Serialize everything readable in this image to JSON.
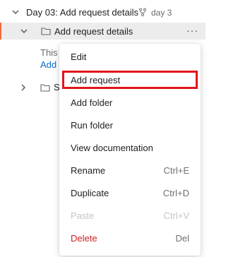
{
  "collection": {
    "title": "Day 03: Add request details",
    "fork_label": "day 3"
  },
  "folder": {
    "title": "Add request details",
    "more": "···"
  },
  "description": {
    "text_fragment": "This",
    "link_fragment": "Add"
  },
  "subfolder": {
    "label_fragment": "S"
  },
  "context_menu": {
    "items": [
      {
        "label": "Edit",
        "shortcut": ""
      },
      {
        "label": "Add request",
        "shortcut": ""
      },
      {
        "label": "Add folder",
        "shortcut": ""
      },
      {
        "label": "Run folder",
        "shortcut": ""
      },
      {
        "label": "View documentation",
        "shortcut": ""
      },
      {
        "label": "Rename",
        "shortcut": "Ctrl+E"
      },
      {
        "label": "Duplicate",
        "shortcut": "Ctrl+D"
      },
      {
        "label": "Paste",
        "shortcut": "Ctrl+V",
        "disabled": true
      },
      {
        "label": "Delete",
        "shortcut": "Del",
        "danger": true
      }
    ],
    "highlighted": "Add request"
  },
  "colors": {
    "accent": "#f26b3a",
    "highlight_box": "#e3141b",
    "danger": "#d01f1f",
    "link": "#0b6bcb"
  }
}
